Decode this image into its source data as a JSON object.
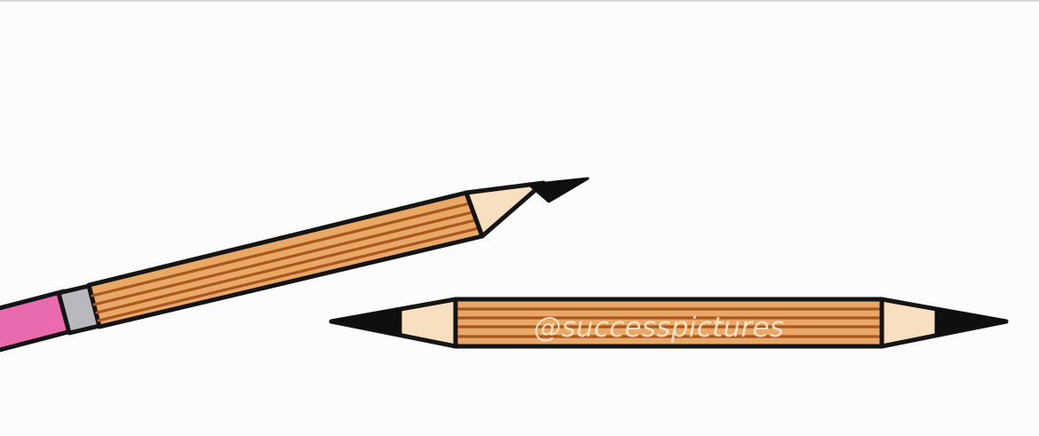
{
  "watermark": {
    "text": "@successpictures"
  },
  "colors": {
    "background": "#fdfcfd",
    "outline": "#141414",
    "wood_body": "#e9a866",
    "wood_stripe": "#a9561f",
    "sharpened_wood": "#f8dfc0",
    "graphite_tip": "#0f0f0f",
    "ferrule": "#b9b9bd",
    "eraser": "#ea6aae"
  },
  "objects": {
    "tilted_pencil": {
      "icon": "pencil-icon",
      "ends": [
        "eraser",
        "sharpened-tip"
      ]
    },
    "double_pencil": {
      "icon": "pencil-icon",
      "ends": [
        "sharpened-tip",
        "sharpened-tip"
      ]
    }
  }
}
